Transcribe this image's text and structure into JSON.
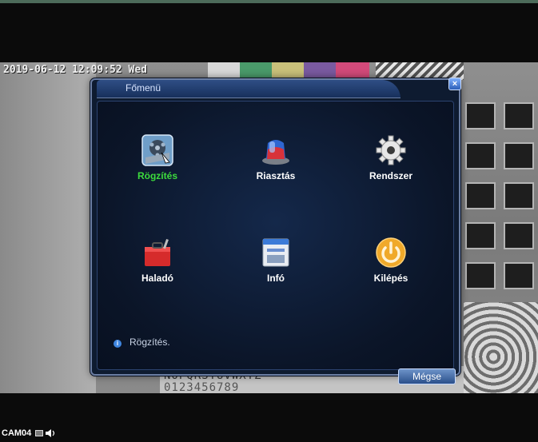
{
  "osd": {
    "datetime": "2019-06-12 12:09:52 Wed"
  },
  "background_text": {
    "line1": "NOPQRSTUVWXYZ",
    "line2": "0123456789"
  },
  "dialog": {
    "title": "Főmenü",
    "close_label": "×",
    "items": [
      {
        "label": "Rögzítés",
        "icon": "record-icon",
        "selected": true
      },
      {
        "label": "Riasztás",
        "icon": "alarm-icon",
        "selected": false
      },
      {
        "label": "Rendszer",
        "icon": "gear-icon",
        "selected": false
      },
      {
        "label": "Haladó",
        "icon": "toolbox-icon",
        "selected": false
      },
      {
        "label": "Infó",
        "icon": "info-window-icon",
        "selected": false
      },
      {
        "label": "Kilépés",
        "icon": "power-icon",
        "selected": false
      }
    ],
    "info_text": "Rögzítés.",
    "cancel_label": "Mégse"
  },
  "status_bar": {
    "camera": "CAM04"
  },
  "colors": {
    "active_label": "#3ddc3d",
    "dialog_bg": "#0e1b30",
    "dialog_border": "#6b7ea3"
  }
}
